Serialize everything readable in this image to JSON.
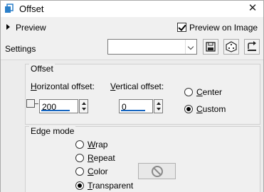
{
  "window": {
    "title": "Offset",
    "close_glyph": "✕"
  },
  "preview": {
    "label": "Preview",
    "preview_on_image_label": "Preview on Image",
    "preview_on_image_checked": true
  },
  "settings": {
    "label": "Settings",
    "preset_value": ""
  },
  "offset": {
    "group_title": "Offset",
    "horizontal_label": "Horizontal offset:",
    "horizontal_value": "200",
    "vertical_label": "Vertical offset:",
    "vertical_value": "0",
    "mode_options": [
      {
        "label": "Center",
        "selected": false
      },
      {
        "label": "Custom",
        "selected": true
      }
    ]
  },
  "edge_mode": {
    "group_title": "Edge mode",
    "options": [
      {
        "label": "Wrap",
        "selected": false
      },
      {
        "label": "Repeat",
        "selected": false
      },
      {
        "label": "Color",
        "selected": false
      },
      {
        "label": "Transparent",
        "selected": true
      }
    ]
  },
  "icons": {
    "app": "offset-app-icon",
    "save_preset": "floppy-disk-icon",
    "randomize": "dice-icon",
    "reset": "reset-arrow-icon",
    "no_color": "no-symbol-icon"
  },
  "colors": {
    "accent_underline": "#1565c0",
    "window_bg": "#f0f0f0"
  }
}
